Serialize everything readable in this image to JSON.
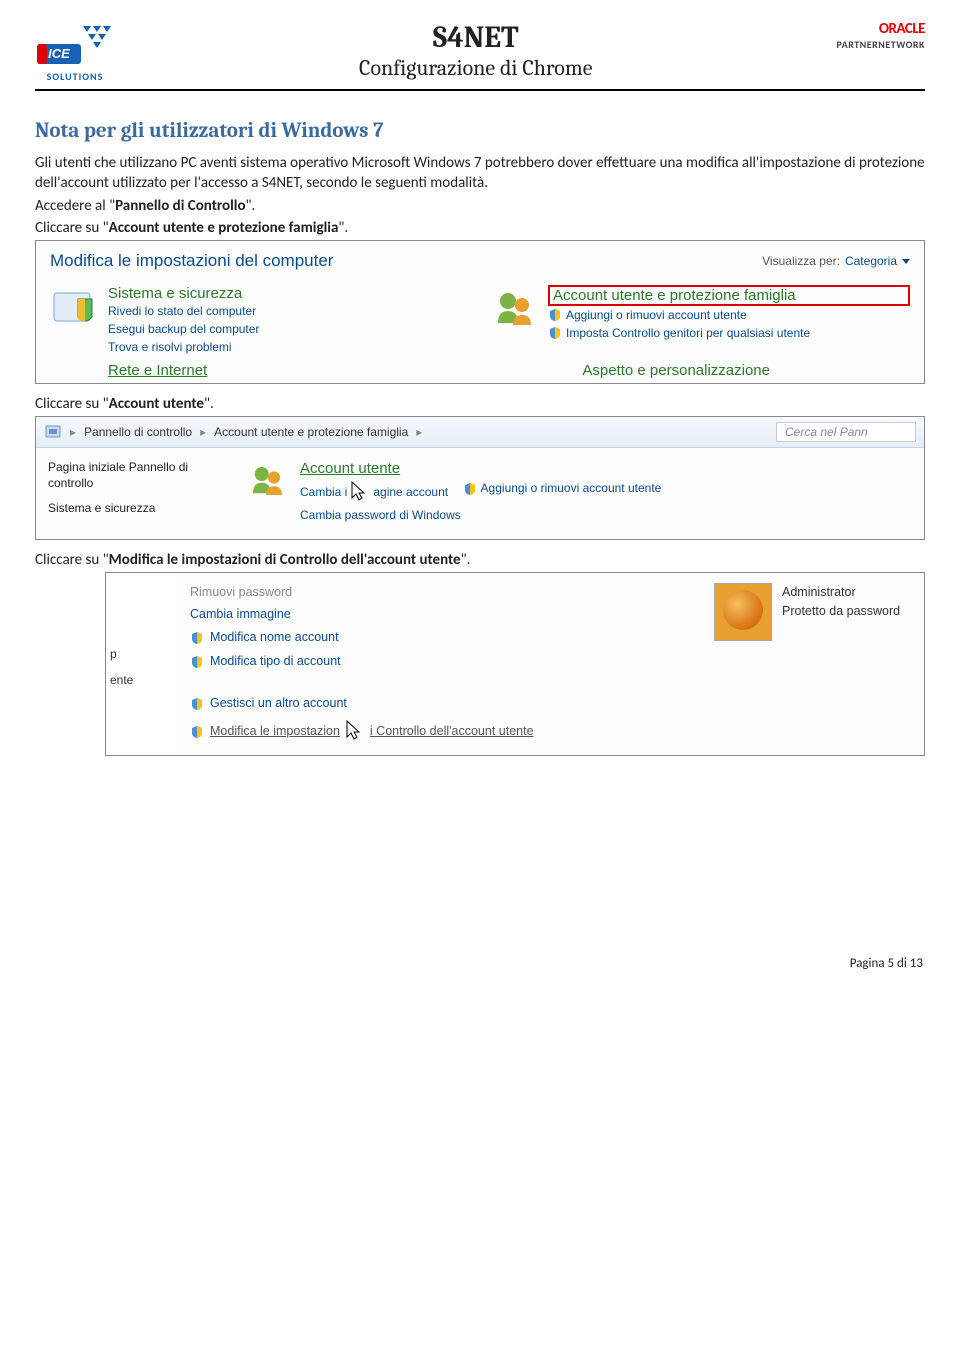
{
  "header": {
    "title": "S4NET",
    "subtitle": "Configurazione di Chrome",
    "logo_left_text": "SOLUTIONS",
    "oracle": "ORACLE",
    "partner": "PARTNERNETWORK"
  },
  "section_title": "Nota per gli utilizzatori di Windows 7",
  "paragraph": "Gli utenti che utilizzano PC aventi sistema operativo Microsoft Windows 7 potrebbero dover effettuare una modifica all'impostazione di protezione dell'account utilizzato per l'accesso a S4NET, secondo le seguenti modalità.",
  "instr1_a": "Accedere al \"",
  "instr1_b": "Pannello di Controllo",
  "instr1_c": "\".",
  "instr2_a": "Cliccare su \"",
  "instr2_b": "Account utente e protezione famiglia",
  "instr2_c": "\".",
  "shot1": {
    "title": "Modifica le impostazioni del computer",
    "viewby_label": "Visualizza per:",
    "viewby_value": "Categoria",
    "left_cat": "Sistema e sicurezza",
    "left_sub1": "Rivedi lo stato del computer",
    "left_sub2": "Esegui backup del computer",
    "left_sub3": "Trova e risolvi problemi",
    "left_bottom": "Rete e Internet",
    "right_cat": "Account utente e protezione famiglia",
    "right_sub1": "Aggiungi o rimuovi account utente",
    "right_sub2": "Imposta Controllo genitori per qualsiasi utente",
    "right_bottom": "Aspetto e personalizzazione"
  },
  "instr3_a": "Cliccare su \"",
  "instr3_b": "Account utente",
  "instr3_c": "\".",
  "shot2": {
    "crumb1": "Pannello di controllo",
    "crumb2": "Account utente e protezione famiglia",
    "search_placeholder": "Cerca nel Pann",
    "left1": "Pagina iniziale Pannello di controllo",
    "left2": "Sistema e sicurezza",
    "title": "Account utente",
    "sub1_pre": "Cambia i",
    "sub1_post": "agine account",
    "sub2": "Aggiungi o rimuovi account utente",
    "sub3": "Cambia password di Windows"
  },
  "instr4_a": "Cliccare su \"",
  "instr4_b": "Modifica le impostazioni di Controllo dell'account utente",
  "instr4_c": "\".",
  "shot3": {
    "left1": "p",
    "left2": "ente",
    "row_top": "Rimuovi password",
    "row1": "Cambia immagine",
    "row2": "Modifica nome account",
    "row3": "Modifica tipo di account",
    "row4": "Gestisci un altro account",
    "row5_pre": "Modifica le impostazion",
    "row5_post": "i Controllo dell'account utente",
    "admin1": "Administrator",
    "admin2": "Protetto da password"
  },
  "footer": "Pagina 5 di 13"
}
